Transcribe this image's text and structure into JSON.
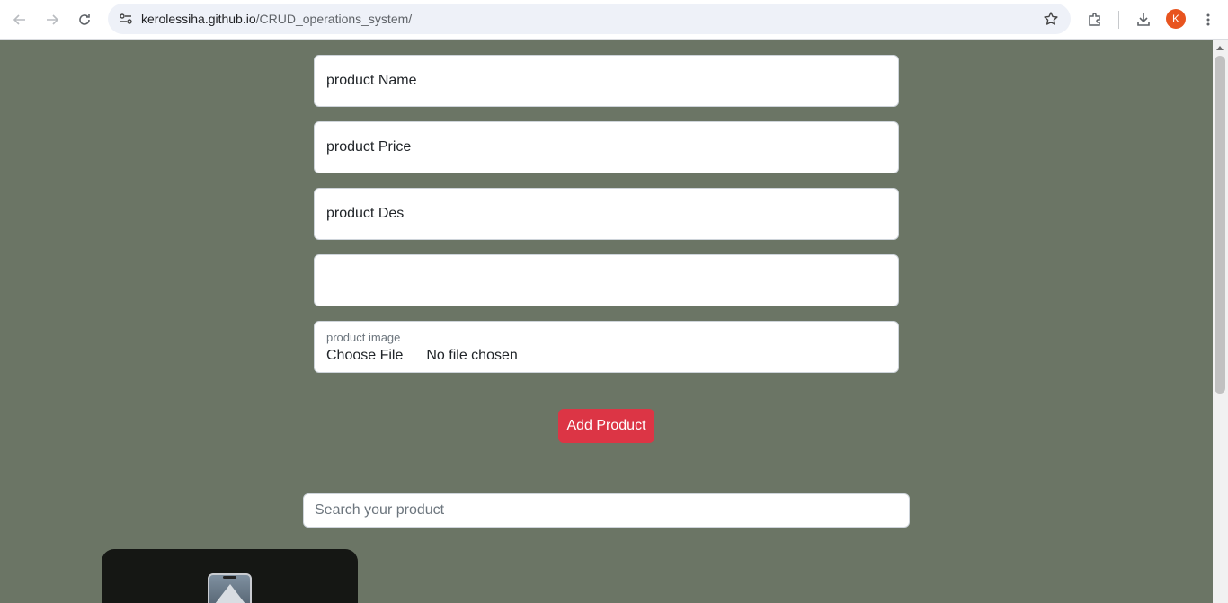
{
  "browser": {
    "url_host": "kerolessiha.github.io",
    "url_path": "/CRUD_operations_system/",
    "profile_initial": "K",
    "icons": [
      "back-icon",
      "forward-icon",
      "reload-icon",
      "site-info-icon",
      "star-icon",
      "extensions-icon",
      "download-icon",
      "more-icon"
    ]
  },
  "form": {
    "name_placeholder": "product Name",
    "price_placeholder": "product Price",
    "des_placeholder": "product Des",
    "category_placeholder": "",
    "image_label": "product image",
    "choose_file": "Choose File",
    "no_file": "No file chosen",
    "add_button": "Add Product"
  },
  "search": {
    "placeholder": "Search your product"
  },
  "colors": {
    "page_bg": "#6b7565",
    "button_bg": "#dc3545",
    "card_bg": "#151714"
  }
}
